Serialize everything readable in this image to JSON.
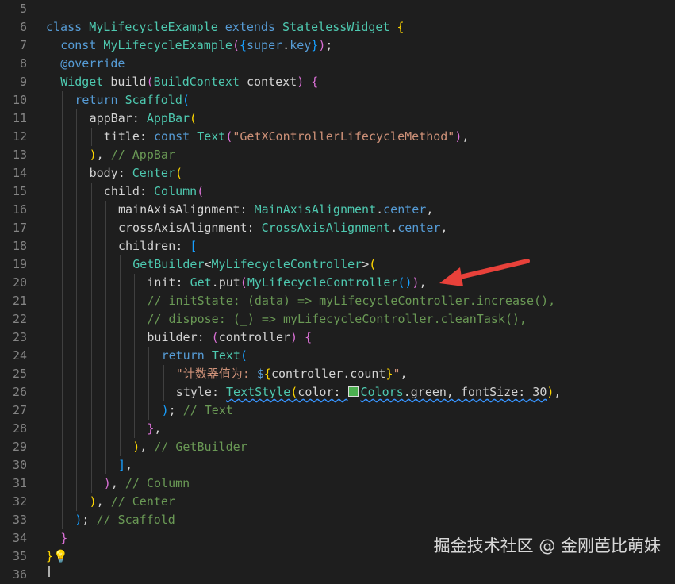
{
  "colors": {
    "background": "#1e1e1e",
    "keyword": "#569cd6",
    "class": "#4ec9b0",
    "string": "#ce9178",
    "comment": "#6a9955",
    "identifier": "#d4d4d4",
    "line_number": "#858585",
    "bracket_1": "#ffd700",
    "bracket_2": "#da70d6",
    "bracket_3": "#179fff",
    "arrow": "#e8413a",
    "color_swatch": "#4caf50"
  },
  "editor": {
    "lines": [
      {
        "n": "5",
        "indent": 0,
        "tokens": []
      },
      {
        "n": "6",
        "indent": 0,
        "tokens": [
          [
            "kw",
            "class "
          ],
          [
            "cls",
            "MyLifecycleExample "
          ],
          [
            "kw",
            "extends "
          ],
          [
            "cls",
            "StatelessWidget "
          ],
          [
            "b1",
            "{"
          ]
        ]
      },
      {
        "n": "7",
        "indent": 1,
        "tokens": [
          [
            "kw",
            "const "
          ],
          [
            "cls",
            "MyLifecycleExample"
          ],
          [
            "b2",
            "("
          ],
          [
            "b3",
            "{"
          ],
          [
            "kw",
            "super"
          ],
          [
            "id",
            "."
          ],
          [
            "kw",
            "key"
          ],
          [
            "b3",
            "}"
          ],
          [
            "b2",
            ")"
          ],
          [
            "id",
            ";"
          ]
        ]
      },
      {
        "n": "8",
        "indent": 1,
        "tokens": [
          [
            "kw",
            "@override"
          ]
        ]
      },
      {
        "n": "9",
        "indent": 1,
        "tokens": [
          [
            "cls",
            "Widget "
          ],
          [
            "id",
            "build"
          ],
          [
            "b2",
            "("
          ],
          [
            "cls",
            "BuildContext "
          ],
          [
            "id",
            "context"
          ],
          [
            "b2",
            ") "
          ],
          [
            "b2",
            "{"
          ]
        ]
      },
      {
        "n": "10",
        "indent": 2,
        "tokens": [
          [
            "kw",
            "return "
          ],
          [
            "cls",
            "Scaffold"
          ],
          [
            "b3",
            "("
          ]
        ]
      },
      {
        "n": "11",
        "indent": 3,
        "tokens": [
          [
            "id",
            "appBar: "
          ],
          [
            "cls",
            "AppBar"
          ],
          [
            "b1",
            "("
          ]
        ]
      },
      {
        "n": "12",
        "indent": 4,
        "tokens": [
          [
            "id",
            "title: "
          ],
          [
            "kw",
            "const "
          ],
          [
            "cls",
            "Text"
          ],
          [
            "b2",
            "("
          ],
          [
            "str",
            "\"GetXControllerLifecycleMethod\""
          ],
          [
            "b2",
            ")"
          ],
          [
            "id",
            ","
          ]
        ]
      },
      {
        "n": "13",
        "indent": 3,
        "tokens": [
          [
            "b1",
            ")"
          ],
          [
            "id",
            ", "
          ],
          [
            "com",
            "// AppBar"
          ]
        ]
      },
      {
        "n": "14",
        "indent": 3,
        "tokens": [
          [
            "id",
            "body: "
          ],
          [
            "cls",
            "Center"
          ],
          [
            "b1",
            "("
          ]
        ]
      },
      {
        "n": "15",
        "indent": 4,
        "tokens": [
          [
            "id",
            "child: "
          ],
          [
            "cls",
            "Column"
          ],
          [
            "b2",
            "("
          ]
        ]
      },
      {
        "n": "16",
        "indent": 5,
        "tokens": [
          [
            "id",
            "mainAxisAlignment: "
          ],
          [
            "cls",
            "MainAxisAlignment"
          ],
          [
            "id",
            "."
          ],
          [
            "kw",
            "center"
          ],
          [
            "id",
            ","
          ]
        ]
      },
      {
        "n": "17",
        "indent": 5,
        "tokens": [
          [
            "id",
            "crossAxisAlignment: "
          ],
          [
            "cls",
            "CrossAxisAlignment"
          ],
          [
            "id",
            "."
          ],
          [
            "kw",
            "center"
          ],
          [
            "id",
            ","
          ]
        ]
      },
      {
        "n": "18",
        "indent": 5,
        "tokens": [
          [
            "id",
            "children: "
          ],
          [
            "b3",
            "["
          ]
        ]
      },
      {
        "n": "19",
        "indent": 6,
        "tokens": [
          [
            "cls",
            "GetBuilder"
          ],
          [
            "id",
            "<"
          ],
          [
            "cls",
            "MyLifecycleController"
          ],
          [
            "id",
            ">"
          ],
          [
            "b1",
            "("
          ]
        ]
      },
      {
        "n": "20",
        "indent": 7,
        "tokens": [
          [
            "id",
            "init: "
          ],
          [
            "cls",
            "Get"
          ],
          [
            "id",
            ".put"
          ],
          [
            "b2",
            "("
          ],
          [
            "cls",
            "MyLifecycleController"
          ],
          [
            "b3",
            "()"
          ],
          [
            "b2",
            ")"
          ],
          [
            "id",
            ","
          ]
        ]
      },
      {
        "n": "21",
        "indent": 7,
        "tokens": [
          [
            "com",
            "// initState: (data) => myLifecycleController.increase(),"
          ]
        ]
      },
      {
        "n": "22",
        "indent": 7,
        "tokens": [
          [
            "com",
            "// dispose: (_) => myLifecycleController.cleanTask(),"
          ]
        ]
      },
      {
        "n": "23",
        "indent": 7,
        "tokens": [
          [
            "id",
            "builder: "
          ],
          [
            "b2",
            "("
          ],
          [
            "id",
            "controller"
          ],
          [
            "b2",
            ") "
          ],
          [
            "b2",
            "{"
          ]
        ]
      },
      {
        "n": "24",
        "indent": 8,
        "tokens": [
          [
            "kw",
            "return "
          ],
          [
            "cls",
            "Text"
          ],
          [
            "b3",
            "("
          ]
        ]
      },
      {
        "n": "25",
        "indent": 9,
        "tokens": [
          [
            "str",
            "\"计数器值为: "
          ],
          [
            "kw",
            "$"
          ],
          [
            "b1",
            "{"
          ],
          [
            "id",
            "controller.count"
          ],
          [
            "b1",
            "}"
          ],
          [
            "str",
            "\""
          ],
          [
            "id",
            ","
          ]
        ]
      },
      {
        "n": "26",
        "indent": 9,
        "tokens": [
          [
            "id",
            "style: "
          ],
          [
            "sq_cls",
            "TextStyle"
          ],
          [
            "sq_b1",
            "("
          ],
          [
            "sq_id",
            "color: "
          ],
          [
            "swatch",
            ""
          ],
          [
            "sq_cls",
            "Colors"
          ],
          [
            "sq_id",
            ".green, fontSize: "
          ],
          [
            "sq_id",
            "30"
          ],
          [
            "b1",
            ")"
          ],
          [
            "id",
            ","
          ]
        ]
      },
      {
        "n": "27",
        "indent": 8,
        "tokens": [
          [
            "b3",
            ")"
          ],
          [
            "id",
            "; "
          ],
          [
            "com",
            "// Text"
          ]
        ]
      },
      {
        "n": "28",
        "indent": 7,
        "tokens": [
          [
            "b2",
            "}"
          ],
          [
            "id",
            ","
          ]
        ]
      },
      {
        "n": "29",
        "indent": 6,
        "tokens": [
          [
            "b1",
            ")"
          ],
          [
            "id",
            ", "
          ],
          [
            "com",
            "// GetBuilder"
          ]
        ]
      },
      {
        "n": "30",
        "indent": 5,
        "tokens": [
          [
            "b3",
            "]"
          ],
          [
            "id",
            ","
          ]
        ]
      },
      {
        "n": "31",
        "indent": 4,
        "tokens": [
          [
            "b2",
            ")"
          ],
          [
            "id",
            ", "
          ],
          [
            "com",
            "// Column"
          ]
        ]
      },
      {
        "n": "32",
        "indent": 3,
        "tokens": [
          [
            "b1",
            ")"
          ],
          [
            "id",
            ", "
          ],
          [
            "com",
            "// Center"
          ]
        ]
      },
      {
        "n": "33",
        "indent": 2,
        "tokens": [
          [
            "b3",
            ")"
          ],
          [
            "id",
            "; "
          ],
          [
            "com",
            "// Scaffold"
          ]
        ]
      },
      {
        "n": "34",
        "indent": 1,
        "tokens": [
          [
            "b2",
            "}"
          ]
        ]
      },
      {
        "n": "35",
        "indent": 0,
        "tokens": [
          [
            "b1",
            "}"
          ],
          [
            "bulb",
            "💡"
          ]
        ]
      },
      {
        "n": "36",
        "indent": 0,
        "tokens": []
      }
    ]
  },
  "annotation": {
    "arrow_icon": "red-arrow-icon"
  },
  "watermark": {
    "text": "掘金技术社区 @ 金刚芭比萌妹"
  }
}
